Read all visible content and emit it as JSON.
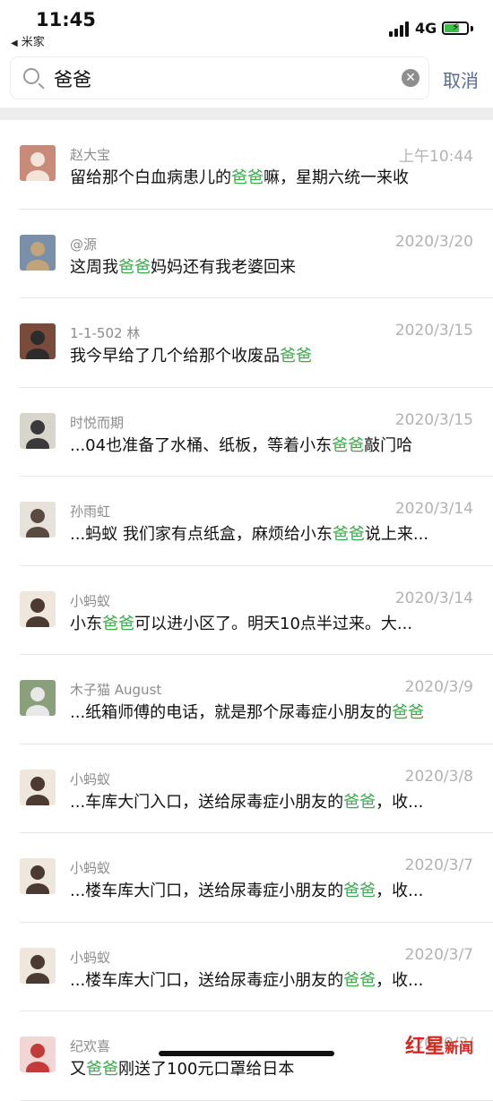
{
  "status": {
    "time": "11:45",
    "back_app": "米家",
    "network": "4G"
  },
  "search": {
    "query": "爸爸",
    "cancel": "取消"
  },
  "results": [
    {
      "name": "赵大宝",
      "date": "上午10:44",
      "pre": "留给那个白血病患儿的",
      "hl": "爸爸",
      "post": "嘛，星期六统一来收",
      "avatar_bg": "#c98a7a",
      "avatar_fg": "#f3e4d9"
    },
    {
      "name": "@源",
      "date": "2020/3/20",
      "pre": "这周我",
      "hl": "爸爸",
      "post": "妈妈还有我老婆回来",
      "avatar_bg": "#7a8fa8",
      "avatar_fg": "#c2a47a"
    },
    {
      "name": "1-1-502 林",
      "date": "2020/3/15",
      "pre": "我今早给了几个给那个收废品",
      "hl": "爸爸",
      "post": "",
      "avatar_bg": "#7a4a3a",
      "avatar_fg": "#2c2c2c"
    },
    {
      "name": "时悦而期",
      "date": "2020/3/15",
      "pre": "...04也准备了水桶、纸板，等着小东",
      "hl": "爸爸",
      "post": "敲门哈",
      "avatar_bg": "#d8d6cc",
      "avatar_fg": "#3a3a3a"
    },
    {
      "name": "孙雨虹",
      "date": "2020/3/14",
      "pre": "...蚂蚁 我们家有点纸盒，麻烦给小东",
      "hl": "爸爸",
      "post": "说上来...",
      "avatar_bg": "#e8e2dc",
      "avatar_fg": "#5a4a42"
    },
    {
      "name": "小蚂蚁",
      "date": "2020/3/14",
      "pre": "小东",
      "hl": "爸爸",
      "post": "可以进小区了。明天10点半过来。大...",
      "avatar_bg": "#efe6dc",
      "avatar_fg": "#4a3a32"
    },
    {
      "name": "木子猫 August",
      "date": "2020/3/9",
      "pre": "...纸箱师傅的电话，就是那个尿毒症小朋友的",
      "hl": "爸爸",
      "post": "",
      "avatar_bg": "#8aa07a",
      "avatar_fg": "#e8e8e8"
    },
    {
      "name": "小蚂蚁",
      "date": "2020/3/8",
      "pre": "...车库大门入口，送给尿毒症小朋友的",
      "hl": "爸爸",
      "post": "，收...",
      "avatar_bg": "#efe6dc",
      "avatar_fg": "#4a3a32"
    },
    {
      "name": "小蚂蚁",
      "date": "2020/3/7",
      "pre": "...楼车库大门口，送给尿毒症小朋友的",
      "hl": "爸爸",
      "post": "，收...",
      "avatar_bg": "#efe6dc",
      "avatar_fg": "#4a3a32"
    },
    {
      "name": "小蚂蚁",
      "date": "2020/3/7",
      "pre": "...楼车库大门口，送给尿毒症小朋友的",
      "hl": "爸爸",
      "post": "，收...",
      "avatar_bg": "#efe6dc",
      "avatar_fg": "#4a3a32"
    },
    {
      "name": "纪欢喜",
      "date": "2020/3/",
      "pre": "又",
      "hl": "爸爸",
      "post": "刚送了100元口罩给日本",
      "avatar_bg": "#f2d6d6",
      "avatar_fg": "#c23a3a"
    }
  ],
  "watermark": {
    "main": "红星",
    "sub": "新闻"
  }
}
